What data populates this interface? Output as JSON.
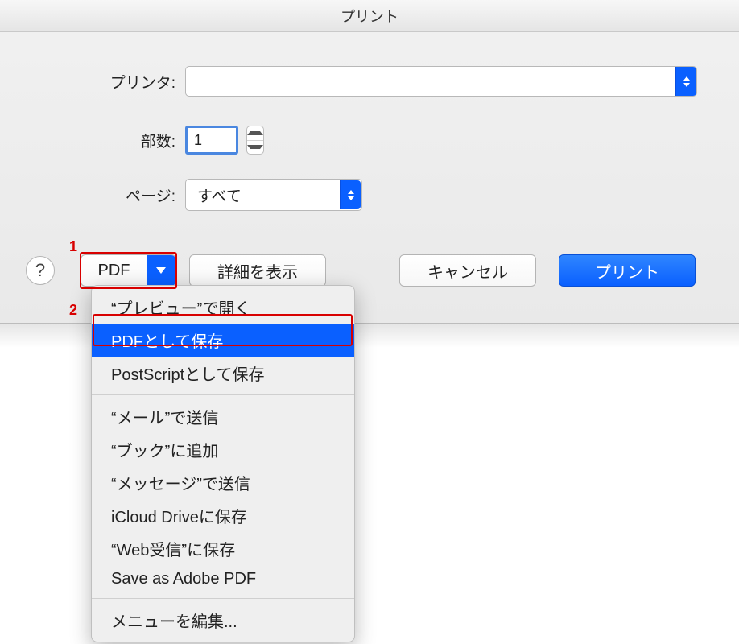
{
  "title": "プリント",
  "printer": {
    "label": "プリンタ:",
    "value": ""
  },
  "copies": {
    "label": "部数:",
    "value": "1"
  },
  "pages": {
    "label": "ページ:",
    "value": "すべて"
  },
  "buttons": {
    "help": "?",
    "pdf": "PDF",
    "details": "詳細を表示",
    "cancel": "キャンセル",
    "print": "プリント"
  },
  "annotations": {
    "a1": "1",
    "a2": "2"
  },
  "menu": {
    "group1": [
      "“プレビュー”で開く",
      "PDFとして保存",
      "PostScriptとして保存"
    ],
    "group2": [
      "“メール”で送信",
      "“ブック”に追加",
      "“メッセージ”で送信",
      "iCloud Driveに保存",
      "“Web受信”に保存",
      "Save as Adobe PDF"
    ],
    "group3": [
      "メニューを編集..."
    ],
    "selected": "PDFとして保存"
  }
}
